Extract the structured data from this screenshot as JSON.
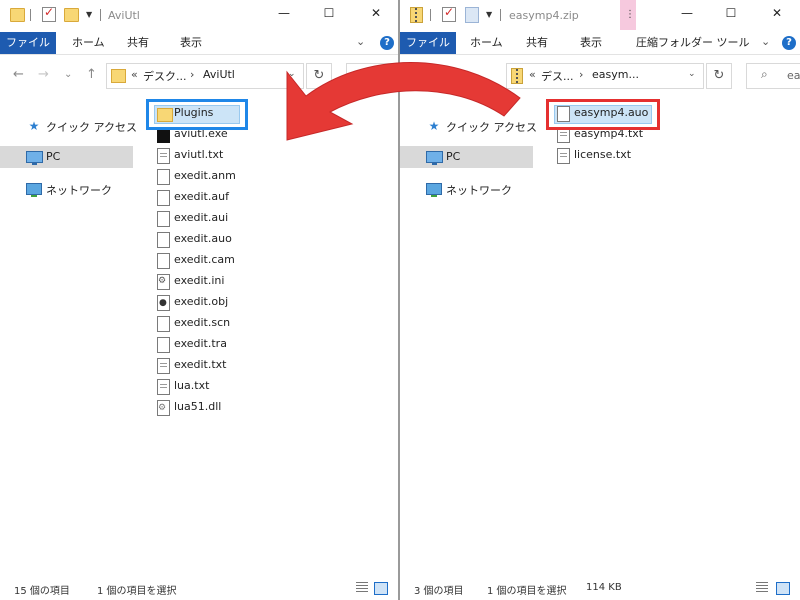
{
  "left_window": {
    "title": "AviUtl",
    "ribbon_tabs": [
      "ファイル",
      "ホーム",
      "共有",
      "表示"
    ],
    "address": {
      "prefix": "«",
      "segments": [
        "デスク...",
        "AviUtl"
      ]
    },
    "nav": [
      "クイック アクセス",
      "PC",
      "ネットワーク"
    ],
    "files": [
      {
        "name": "Plugins",
        "icon": "folder-icon"
      },
      {
        "name": "aviutl.exe",
        "icon": "exe-icon"
      },
      {
        "name": "aviutl.txt",
        "icon": "text-file-icon"
      },
      {
        "name": "exedit.anm",
        "icon": "file-icon"
      },
      {
        "name": "exedit.auf",
        "icon": "file-icon"
      },
      {
        "name": "exedit.aui",
        "icon": "file-icon"
      },
      {
        "name": "exedit.auo",
        "icon": "file-icon"
      },
      {
        "name": "exedit.cam",
        "icon": "file-icon"
      },
      {
        "name": "exedit.ini",
        "icon": "settings-file-icon"
      },
      {
        "name": "exedit.obj",
        "icon": "object-file-icon"
      },
      {
        "name": "exedit.scn",
        "icon": "file-icon"
      },
      {
        "name": "exedit.tra",
        "icon": "file-icon"
      },
      {
        "name": "exedit.txt",
        "icon": "text-file-icon"
      },
      {
        "name": "lua.txt",
        "icon": "text-file-icon"
      },
      {
        "name": "lua51.dll",
        "icon": "dll-file-icon"
      }
    ],
    "status": {
      "count": "15 個の項目",
      "selection": "1 個の項目を選択"
    }
  },
  "right_window": {
    "title": "easymp4.zip",
    "ribbon_tabs": [
      "ファイル",
      "ホーム",
      "共有",
      "表示",
      "圧縮フォルダー ツール"
    ],
    "context_tab_glyph": "⋮",
    "address": {
      "prefix": "«",
      "segments": [
        "デス...",
        "easym..."
      ]
    },
    "search_glyph": "⌕",
    "search_text": "ea",
    "nav": [
      "クイック アクセス",
      "PC",
      "ネットワーク"
    ],
    "files": [
      {
        "name": "easymp4.auo",
        "icon": "file-icon"
      },
      {
        "name": "easymp4.txt",
        "icon": "text-file-icon"
      },
      {
        "name": "license.txt",
        "icon": "text-file-icon"
      }
    ],
    "status": {
      "count": "3 個の項目",
      "selection": "1 個の項目を選択",
      "size": "114 KB"
    }
  },
  "window_controls": {
    "minimize": "—",
    "maximize": "☐",
    "close": "✕"
  },
  "nav_glyphs": {
    "back": "←",
    "forward": "→",
    "recent": "⌄",
    "up": "↑",
    "refresh": "↻",
    "address_dropdown": "⌄",
    "breadcrumb_sep": "›"
  },
  "colors": {
    "highlight_target": "#1f87e8",
    "highlight_source": "#e53030",
    "arrow": "#e53935",
    "file_tab": "#1e5bb0"
  }
}
